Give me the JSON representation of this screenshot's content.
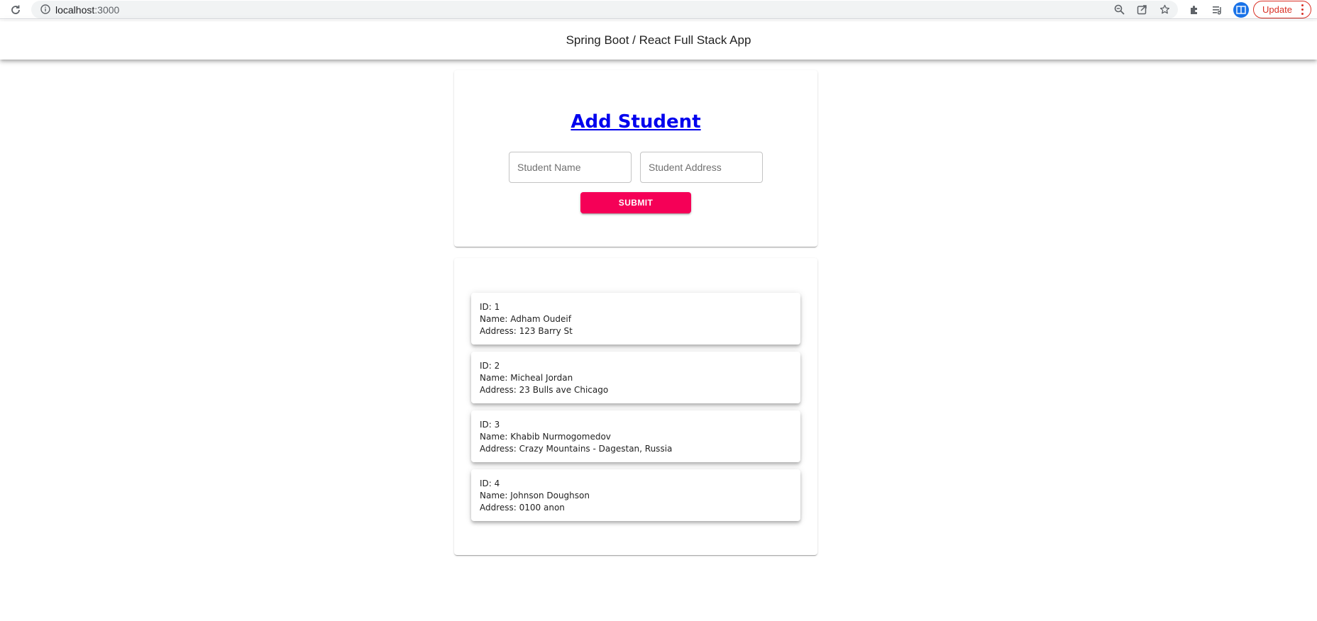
{
  "browser": {
    "url_host": "localhost",
    "url_port": ":3000",
    "update_label": "Update"
  },
  "header": {
    "title": "Spring Boot / React Full Stack App"
  },
  "form": {
    "title": "Add Student",
    "name_placeholder": "Student Name",
    "address_placeholder": "Student Address",
    "submit_label": "SUBMIT"
  },
  "students": [
    {
      "id_line": "ID: 1",
      "name_line": "Name: Adham Oudeif",
      "address_line": "Address: 123 Barry St"
    },
    {
      "id_line": "ID: 2",
      "name_line": "Name: Micheal Jordan",
      "address_line": "Address: 23 Bulls ave Chicago"
    },
    {
      "id_line": "ID: 3",
      "name_line": "Name: Khabib Nurmogomedov",
      "address_line": "Address: Crazy Mountains - Dagestan, Russia"
    },
    {
      "id_line": "ID: 4",
      "name_line": "Name: Johnson Doughson",
      "address_line": "Address: 0100 anon"
    }
  ],
  "colors": {
    "accent": "#f50057",
    "link": "#0000ee",
    "update": "#d93025"
  },
  "icons": [
    "reload-icon",
    "info-icon",
    "zoom-icon",
    "share-icon",
    "bookmark-star-icon",
    "extensions-icon",
    "reading-list-icon",
    "profile-icon",
    "menu-dots-icon"
  ]
}
